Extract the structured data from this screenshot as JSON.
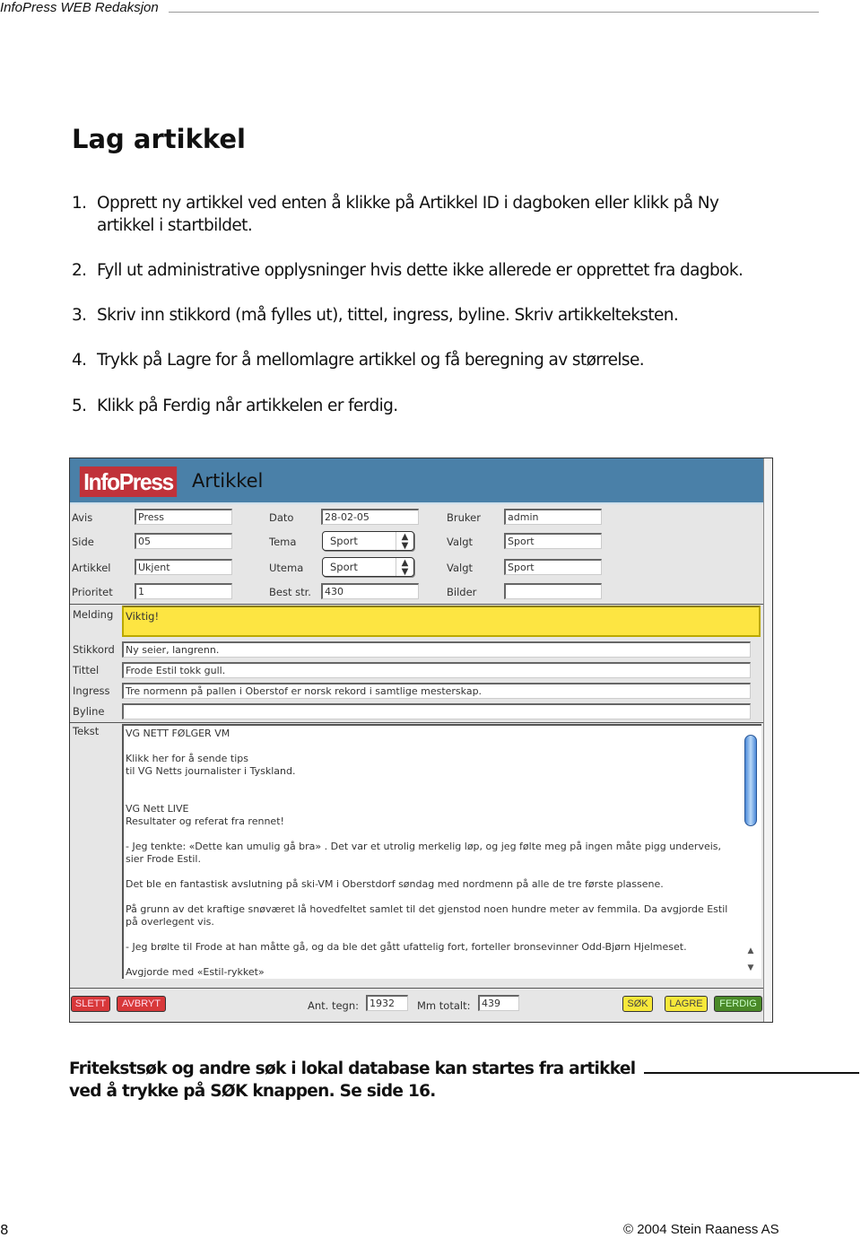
{
  "running_header": "InfoPress WEB Redaksjon",
  "title": "Lag artikkel",
  "steps": [
    {
      "num": "1.",
      "text": "Opprett ny artikkel ved enten å klikke på Artikkel ID i dagboken eller klikk på Ny artikkel i startbildet."
    },
    {
      "num": "2.",
      "text": "Fyll ut administrative opplysninger hvis dette ikke allerede er opprettet fra dagbok."
    },
    {
      "num": "3.",
      "text": "Skriv inn stikkord (må fylles ut), tittel, ingress, byline. Skriv artikkelteksten."
    },
    {
      "num": "4.",
      "text": "Trykk på Lagre for å mellomlagre artikkel og få beregning av størrelse."
    },
    {
      "num": "5.",
      "text": "Klikk på Ferdig når artikkelen er ferdig."
    }
  ],
  "app": {
    "logo": "InfoPress",
    "title": "Artikkel",
    "header_color": "#4a80a8",
    "fields": {
      "avis": {
        "label": "Avis",
        "value": "Press"
      },
      "side": {
        "label": "Side",
        "value": "05"
      },
      "artikkel": {
        "label": "Artikkel",
        "value": "Ukjent"
      },
      "prioritet": {
        "label": "Prioritet",
        "value": "1"
      },
      "dato": {
        "label": "Dato",
        "value": "28-02-05"
      },
      "tema": {
        "label": "Tema",
        "value": "Sport"
      },
      "utema": {
        "label": "Utema",
        "value": "Sport"
      },
      "best_str": {
        "label": "Best str.",
        "value": "430"
      },
      "bruker": {
        "label": "Bruker",
        "value": "admin"
      },
      "valgt1": {
        "label": "Valgt",
        "value": "Sport"
      },
      "valgt2": {
        "label": "Valgt",
        "value": "Sport"
      },
      "bilder": {
        "label": "Bilder",
        "value": ""
      },
      "melding": {
        "label": "Melding",
        "value": "Viktig!"
      },
      "stikkord": {
        "label": "Stikkord",
        "value": "Ny seier, langrenn."
      },
      "tittel": {
        "label": "Tittel",
        "value": "Frode Estil tokk gull."
      },
      "ingress": {
        "label": "Ingress",
        "value": "Tre normenn på pallen i Oberstof er norsk rekord i samtlige mesterskap."
      },
      "byline": {
        "label": "Byline",
        "value": ""
      },
      "tekst": {
        "label": "Tekst",
        "value": "VG NETT FØLGER VM\n\nKlikk her for å sende tips\ntil VG Netts journalister i Tyskland.\n\n\nVG Nett LIVE\nResultater og referat fra rennet!\n\n- Jeg tenkte: «Dette kan umulig gå bra» . Det var et utrolig merkelig løp, og jeg følte meg på ingen måte pigg underveis, sier Frode Estil.\n\nDet ble en fantastisk avslutning på ski-VM i Oberstdorf søndag med nordmenn på alle de tre første plassene.\n\nPå grunn av det kraftige snøværet lå hovedfeltet samlet til det gjenstod noen hundre meter av femmila. Da avgjorde Estil på overlegent vis.\n\n- Jeg brølte til Frode at han måtte gå, og da ble det gått ufattelig fort, forteller bronsevinner Odd-Bjørn Hjelmeset.\n\nAvgjorde med «Estil-rykket»"
      }
    },
    "footer": {
      "slett": "SLETT",
      "avbryt": "AVBRYT",
      "ant_tegn_label": "Ant. tegn:",
      "ant_tegn": "1932",
      "mm_totalt_label": "Mm totalt:",
      "mm_totalt": "439",
      "sok": "SØK",
      "lagre": "LAGRE",
      "ferdig": "FERDIG"
    }
  },
  "caption": "Fritekstsøk og andre søk i lokal database kan startes fra artikkel ved å trykke på SØK knappen. Se side 16.",
  "page_number": "8",
  "copyright": "© 2004 Stein Raaness AS"
}
